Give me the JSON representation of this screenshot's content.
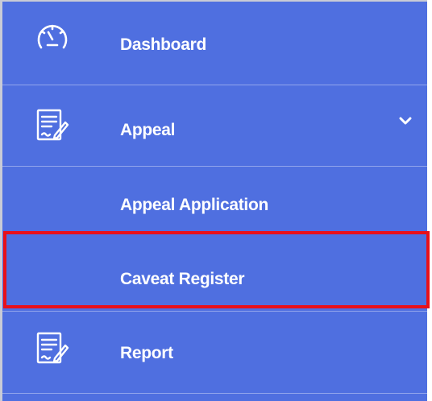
{
  "sidebar": {
    "items": [
      {
        "label": "Dashboard",
        "icon": "speedometer-icon"
      },
      {
        "label": "Appeal",
        "icon": "document-edit-icon",
        "expanded": true
      },
      {
        "label": "Appeal Application"
      },
      {
        "label": "Caveat Register",
        "highlighted": true
      },
      {
        "label": "Report",
        "icon": "document-edit-icon"
      }
    ]
  },
  "colors": {
    "background": "#4f6fe0",
    "text": "#ffffff",
    "highlight": "#e8101a"
  }
}
